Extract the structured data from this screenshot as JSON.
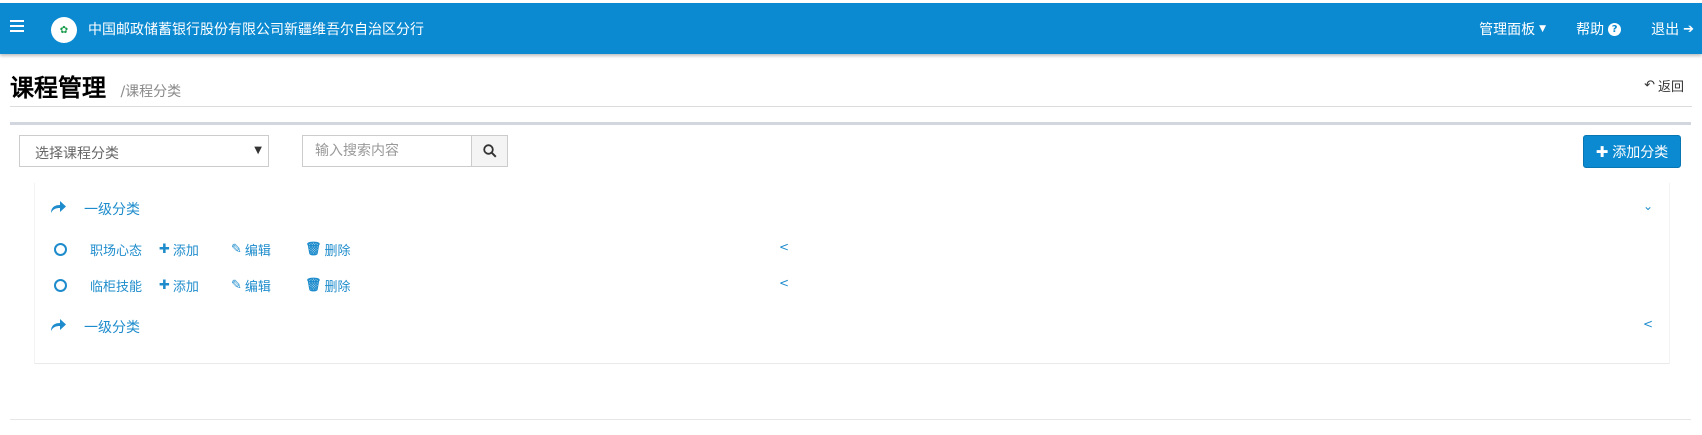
{
  "header": {
    "menu_icon": "hamburger-icon",
    "logo_text": "中国邮政",
    "brand": "中国邮政储蓄银行股份有限公司新疆维吾尔自治区分行",
    "nav": {
      "dashboard": "管理面板",
      "help": "帮助",
      "logout": "退出"
    }
  },
  "page": {
    "title": "课程管理",
    "breadcrumb": "/课程分类",
    "back": "返回"
  },
  "toolbar": {
    "select_value": "选择课程分类",
    "search_placeholder": "输入搜索内容",
    "add_label": "添加分类"
  },
  "tree": {
    "categories": [
      {
        "label": "一级分类",
        "children": [
          {
            "name": "职场心态",
            "add": "添加",
            "edit": "编辑",
            "delete": "删除"
          },
          {
            "name": "临柜技能",
            "add": "添加",
            "edit": "编辑",
            "delete": "删除"
          }
        ]
      },
      {
        "label": "一级分类",
        "children": []
      }
    ]
  },
  "colors": {
    "header_bg": "#0b8ad1",
    "link": "#1e8ccc",
    "primary_button": "#0b8ad1"
  }
}
